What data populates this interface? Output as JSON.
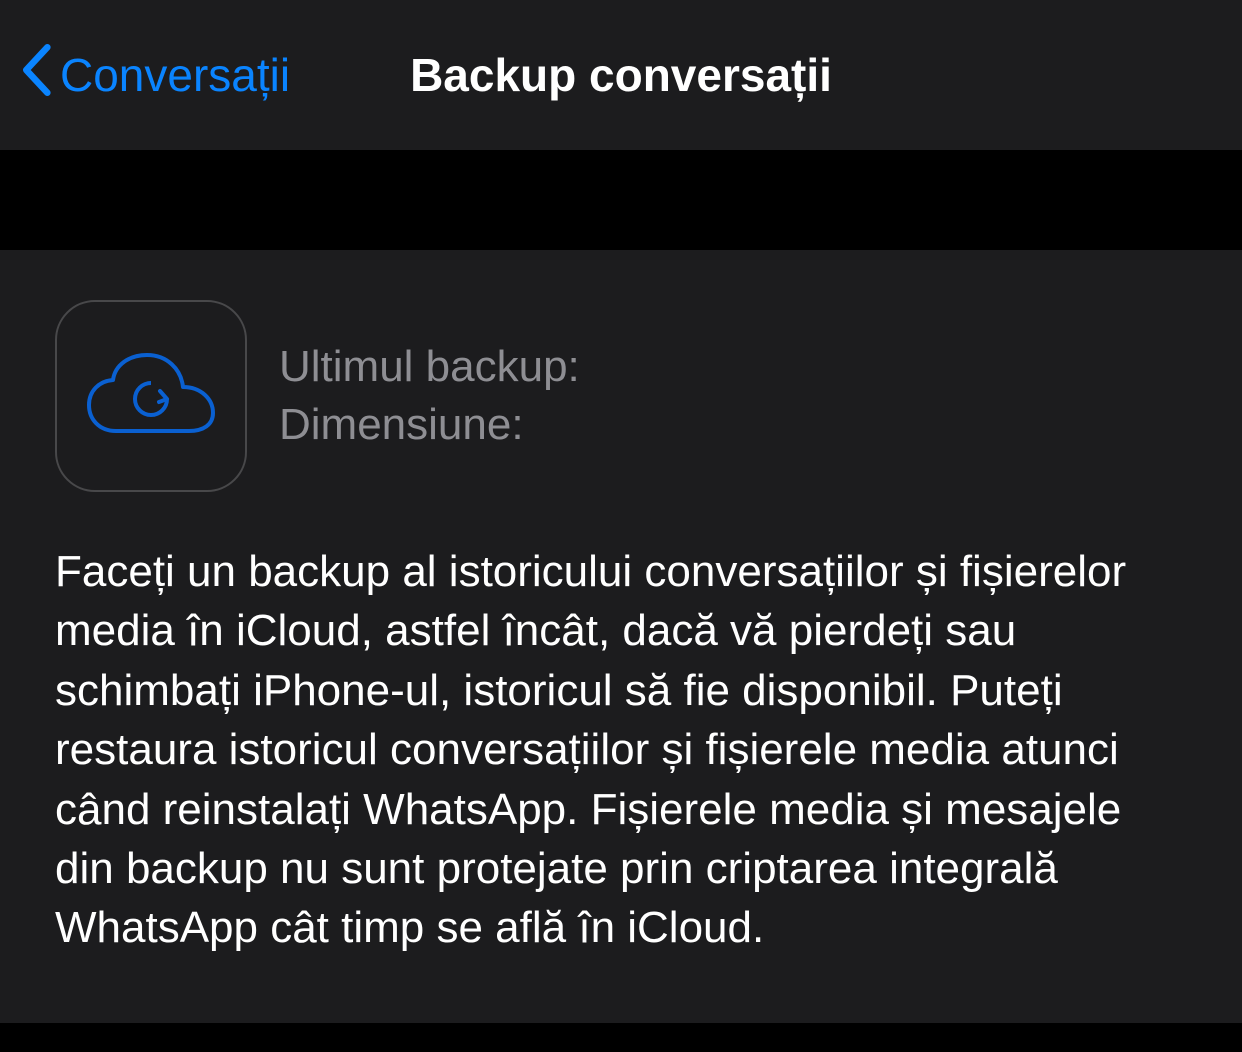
{
  "nav": {
    "back_label": "Conversații",
    "title": "Backup conversații"
  },
  "backup_info": {
    "last_backup_label": "Ultimul backup:",
    "size_label": "Dimensiune:"
  },
  "description": "Faceți un backup al istoricului conversațiilor și fișierelor media în iCloud, astfel încât, dacă vă pierdeți sau schimbați iPhone-ul, istoricul să fie disponibil. Puteți restaura istoricul conversațiilor și fișierele media atunci când reinstalați WhatsApp. Fișierele media și mesajele din backup nu sunt protejate prin criptarea integrală WhatsApp cât timp se află în iCloud."
}
